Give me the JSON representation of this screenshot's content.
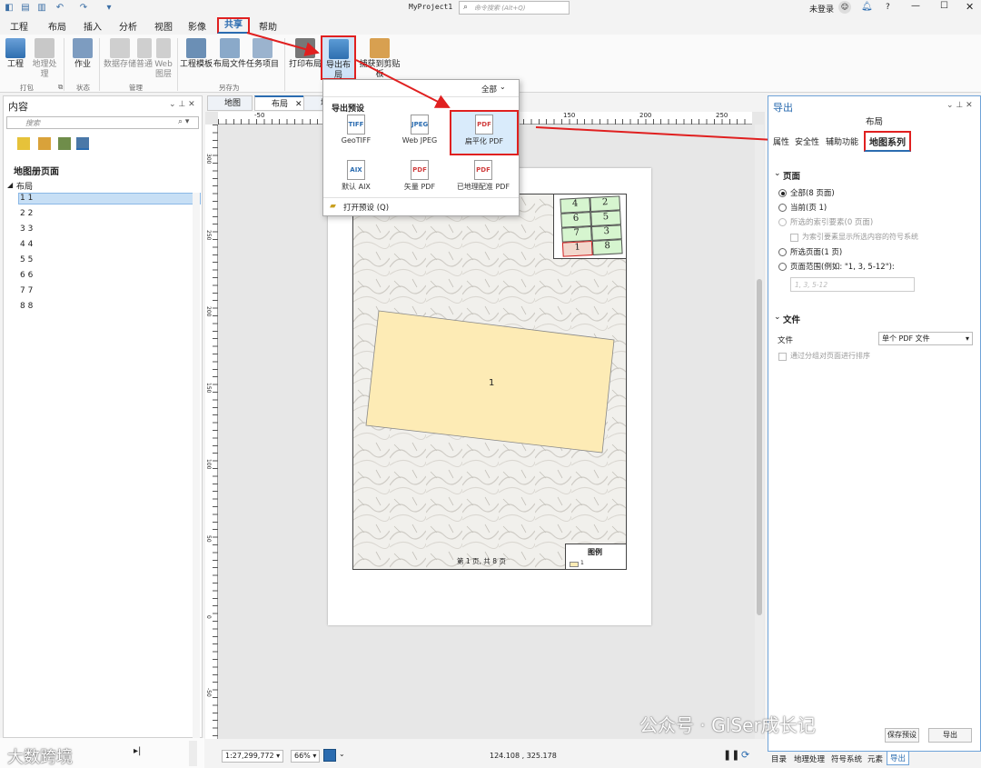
{
  "app": {
    "project_title": "MyProject1",
    "search_placeholder": "命令搜索 (Alt+Q)",
    "login": "未登录",
    "help": "?"
  },
  "menu": [
    "工程",
    "布局",
    "插入",
    "分析",
    "视图",
    "影像",
    "共享",
    "帮助"
  ],
  "ribbon": {
    "buttons": [
      {
        "label": "工程"
      },
      {
        "label": "地理处理"
      },
      {
        "label": "作业"
      },
      {
        "label": "数据存储"
      },
      {
        "label": "普通"
      },
      {
        "label": "Web 图层"
      },
      {
        "label": "工程模板"
      },
      {
        "label": "布局文件"
      },
      {
        "label": "任务项目"
      },
      {
        "label": "打印布局"
      },
      {
        "label": "导出布局"
      },
      {
        "label": "捕获到剪贴板"
      }
    ],
    "groups": [
      "打包",
      "状态",
      "管理",
      "另存为"
    ]
  },
  "dropdown": {
    "filter": "全部",
    "section": "导出预设",
    "presets": [
      {
        "label": "GeoTIFF",
        "badge": "TIFF"
      },
      {
        "label": "Web JPEG",
        "badge": "JPEG"
      },
      {
        "label": "扁平化 PDF",
        "badge": "PDF"
      },
      {
        "label": "默认 AIX",
        "badge": "AIX"
      },
      {
        "label": "矢量 PDF",
        "badge": "PDF"
      },
      {
        "label": "已地理配准 PDF",
        "badge": "PDF"
      }
    ],
    "open_preset": "打开预设 (Q)"
  },
  "contents": {
    "title": "内容",
    "search_placeholder": "搜索",
    "heading": "地图册页面",
    "layout_node": "布局",
    "pages": [
      "1 1",
      "2 2",
      "3 3",
      "4 4",
      "5 5",
      "6 6",
      "7 7",
      "8 8"
    ]
  },
  "view_tabs": [
    "地图",
    "布局",
    "地"
  ],
  "ruler": {
    "h": [
      "-50",
      "0",
      "50",
      "100",
      "150",
      "200",
      "250"
    ],
    "v": [
      "300",
      "250",
      "200",
      "150",
      "100",
      "50",
      "0",
      "-50"
    ]
  },
  "map": {
    "index_grid": [
      "4",
      "2",
      "6",
      "5",
      "7",
      "3",
      "1",
      "8"
    ],
    "feature_label": "1",
    "page_text": "第 1 页, 共 8 页",
    "legend_title": "图例",
    "legend_item": "1"
  },
  "status": {
    "scale": "1:27,299,772",
    "zoom": "66%",
    "coords": "124.108 , 325.178"
  },
  "export": {
    "pane_title": "导出",
    "subtitle": "布局",
    "tabs": [
      "属性",
      "安全性",
      "辅助功能",
      "地图系列"
    ],
    "pages_section": "页面",
    "options": [
      "全部(8 页面)",
      "当前(页 1)",
      "所选的索引要素(0 页面)",
      "所选页面(1 页)",
      "页面范围(例如: \"1, 3, 5-12\"):"
    ],
    "sub_check": "为索引要素显示所选内容的符号系统",
    "range_placeholder": "1, 3, 5-12",
    "file_section": "文件",
    "file_label": "文件",
    "file_value": "单个 PDF 文件",
    "group_check": "通过分组对页面进行排序",
    "save_preset": "保存预设",
    "export_btn": "导出"
  },
  "bottom_tabs": [
    "目录",
    "地理处理",
    "符号系统",
    "元素",
    "导出"
  ],
  "watermark": {
    "left": "大数跨境",
    "right": "公众号 · GISer成长记"
  },
  "colors": {
    "accent": "#2b6cb0",
    "highlight": "#e02020",
    "feature_fill": "#fdebb5",
    "grid_fill": "#d6f5cf"
  }
}
